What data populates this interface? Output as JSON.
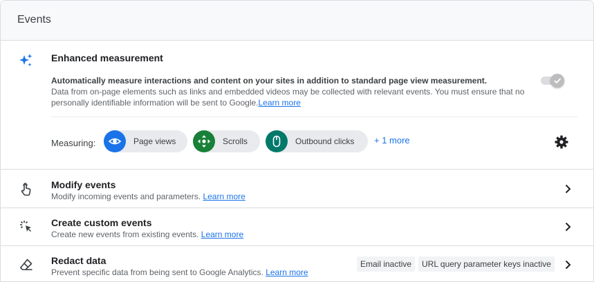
{
  "header": {
    "title": "Events"
  },
  "enhanced": {
    "title": "Enhanced measurement",
    "desc_bold": "Automatically measure interactions and content on your sites in addition to standard page view measurement.",
    "desc": "Data from on-page elements such as links and embedded videos may be collected with relevant events. You must ensure that no personally identifiable information will be sent to Google.",
    "learn_more": "Learn more",
    "toggle_state": "on (disabled)",
    "measuring_label": "Measuring:",
    "chips": [
      {
        "label": "Page views",
        "icon": "eye-icon",
        "color": "#1a73e8"
      },
      {
        "label": "Scrolls",
        "icon": "scroll-arrows-icon",
        "color": "#188038"
      },
      {
        "label": "Outbound clicks",
        "icon": "mouse-icon",
        "color": "#00796b"
      }
    ],
    "more": "+ 1 more"
  },
  "rows": [
    {
      "title": "Modify events",
      "sub": "Modify incoming events and parameters.",
      "link": "Learn more",
      "icon": "touch-hand-icon"
    },
    {
      "title": "Create custom events",
      "sub": "Create new events from existing events.",
      "link": "Learn more",
      "icon": "cursor-click-icon"
    },
    {
      "title": "Redact data",
      "sub": "Prevent specific data from being sent to Google Analytics.",
      "link": "Learn more",
      "icon": "eraser-icon",
      "badges": [
        "Email inactive",
        "URL query parameter keys inactive"
      ]
    }
  ]
}
